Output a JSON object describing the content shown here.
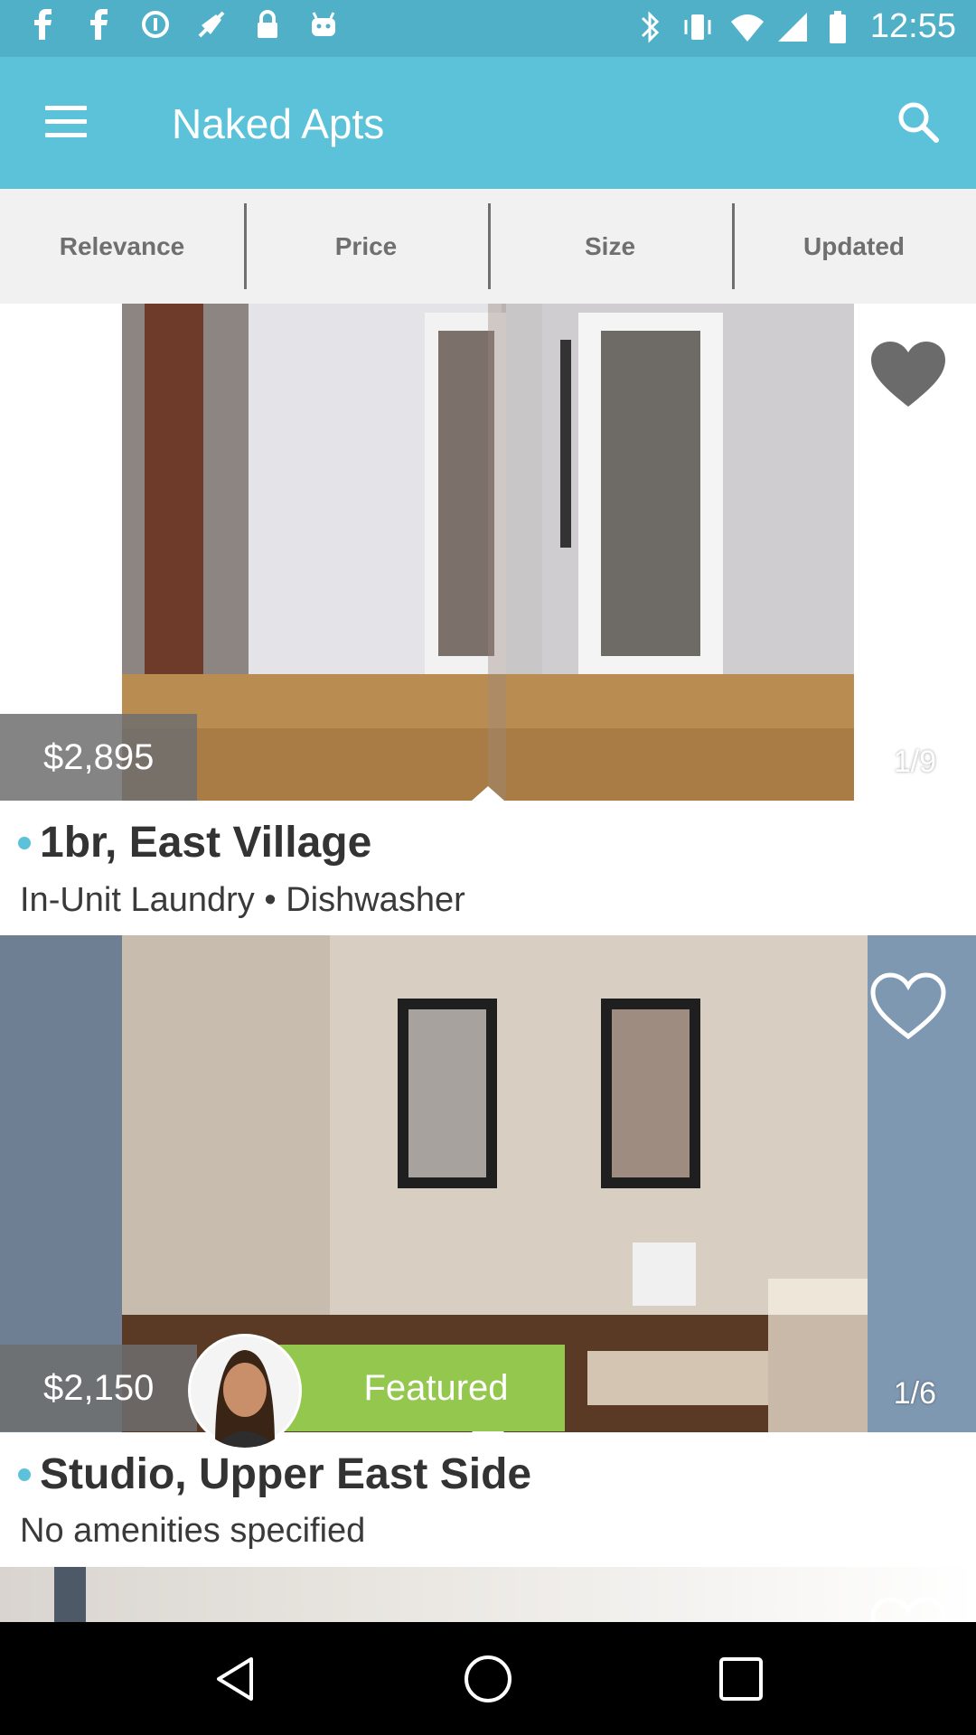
{
  "status_bar": {
    "time": "12:55",
    "left_icons": [
      "facebook-icon",
      "facebook-icon",
      "data-saver-icon",
      "no-location-icon",
      "lock-icon",
      "android-icon"
    ],
    "right_icons": [
      "bluetooth-icon",
      "vibrate-icon",
      "wifi-icon",
      "signal-icon",
      "battery-icon"
    ]
  },
  "app_bar": {
    "title": "Naked Apts",
    "menu_icon": "menu-icon",
    "search_icon": "search-icon",
    "background": "#5bc2da"
  },
  "sort_tabs": [
    {
      "label": "Relevance"
    },
    {
      "label": "Price"
    },
    {
      "label": "Size"
    },
    {
      "label": "Updated"
    }
  ],
  "listings": [
    {
      "price": "$2,895",
      "photo_counter": "1/9",
      "favorited": true,
      "title": "1br, East Village",
      "amenities": "In-Unit Laundry • Dishwasher"
    },
    {
      "price": "$2,150",
      "badge": "Featured",
      "photo_counter": "1/6",
      "favorited": false,
      "title": "Studio, Upper East Side",
      "amenities": "No amenities specified"
    }
  ],
  "colors": {
    "accent": "#5bc2da",
    "featured": "#93c74e",
    "heart": "#6b6b6b"
  },
  "nav": {
    "back_icon": "back-icon",
    "home_icon": "home-icon",
    "recents_icon": "recents-icon"
  }
}
